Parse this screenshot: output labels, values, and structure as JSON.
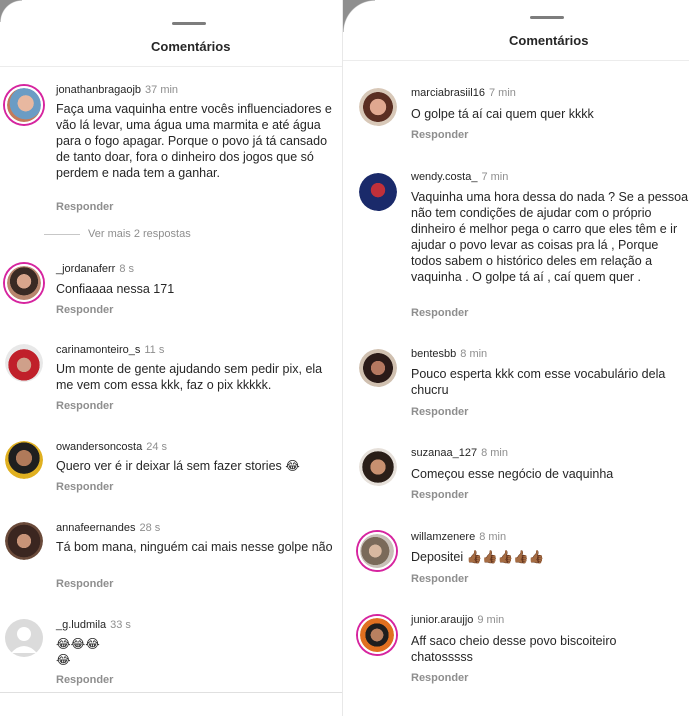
{
  "left": {
    "title": "Comentários",
    "comments": [
      {
        "user": "jonathanbragaojb",
        "time": "37 min",
        "text": "Faça uma vaquinha entre vocês influenciadores e vão lá levar, uma água uma marmita e até água para o fogo apagar. Porque o povo já tá cansado de tanto doar, fora o dinheiro dos jogos que só perdem e nada tem a ganhar.",
        "reply": "Responder"
      },
      {
        "user": "_jordanaferr",
        "time": "8 s",
        "text": "Confiaaaa nessa 171",
        "reply": "Responder"
      },
      {
        "user": "carinamonteiro_s",
        "time": "11 s",
        "text": "Um monte de gente ajudando sem pedir pix, ela me vem com essa kkk, faz o pix kkkkk.",
        "reply": "Responder"
      },
      {
        "user": "owandersoncosta",
        "time": "24 s",
        "text": "Quero ver é ir deixar lá sem fazer stories 😂",
        "reply": "Responder"
      },
      {
        "user": "annafeernandes",
        "time": "28 s",
        "text": "Tá bom mana, ninguém cai mais nesse golpe não",
        "reply": "Responder"
      },
      {
        "user": "_g.ludmila",
        "time": "33 s",
        "text": "😂😂😂\n😂",
        "reply": "Responder"
      }
    ],
    "more_replies": "Ver mais 2 respostas"
  },
  "right": {
    "title": "Comentários",
    "comments": [
      {
        "user": "marciabrasiil16",
        "time": "7 min",
        "text": "O golpe tá aí cai quem quer kkkk",
        "reply": "Responder"
      },
      {
        "user": "wendy.costa_",
        "time": "7 min",
        "text": "Vaquinha uma hora dessa do nada ? Se a pessoa não tem condições de ajudar com o próprio dinheiro é melhor pega o carro que eles têm e ir ajudar o povo levar as coisas pra lá , Porque todos sabem o histórico deles em relação a vaquinha . O golpe tá aí , caí quem quer .",
        "reply": "Responder"
      },
      {
        "user": "bentesbb",
        "time": "8 min",
        "text": "Pouco esperta kkk com esse vocabulário dela chucru",
        "reply": "Responder"
      },
      {
        "user": "suzanaa_127",
        "time": "8 min",
        "text": "Começou esse negócio de vaquinha",
        "reply": "Responder"
      },
      {
        "user": "willamzenere",
        "time": "8 min",
        "text": "Depositei 👍🏾👍🏾👍🏾👍🏾👍🏾",
        "reply": "Responder"
      },
      {
        "user": "junior.araujjo",
        "time": "9 min",
        "text": "Aff saco cheio desse povo biscoiteiro chatosssss",
        "reply": "Responder"
      }
    ]
  },
  "colors": {
    "story_ring": "#d6249f",
    "muted": "#8e8e8e",
    "text": "#262626"
  }
}
